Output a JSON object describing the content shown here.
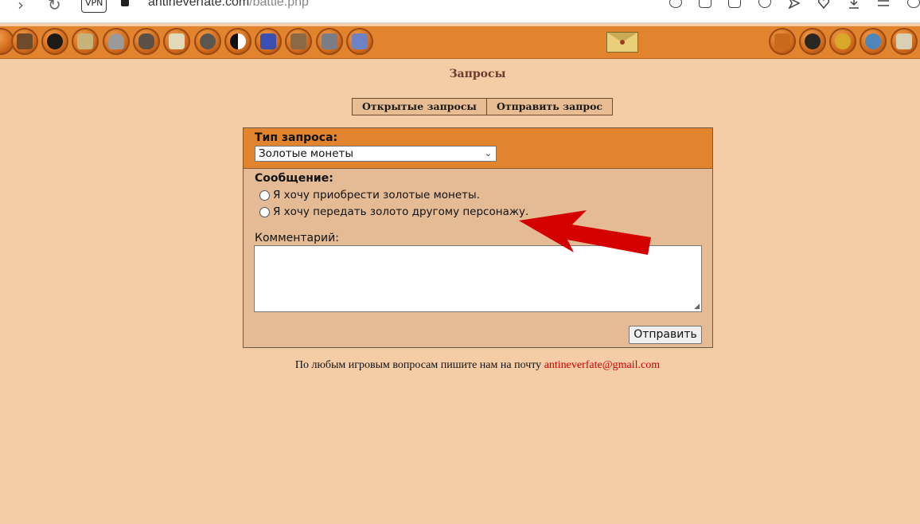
{
  "browser": {
    "vpn_label": "VPN",
    "url_domain": "antineverfate.com",
    "url_path": "/battle.php"
  },
  "toolbar": {
    "left_icons": [
      "castle-gate-icon",
      "dragon-icon",
      "book-icon",
      "helmet-icon",
      "tiger-icon",
      "scroll-icon",
      "pentagram-icon",
      "yin-yang-icon",
      "crossed-swords-icon",
      "fence-icon",
      "ship-icon",
      "tools-icon"
    ],
    "mail_icon": "envelope-icon",
    "right_icons": [
      "home-icon",
      "exit-icon",
      "help-icon",
      "info-icon",
      "rules-book-icon"
    ]
  },
  "page": {
    "title": "Запросы",
    "tabs": [
      {
        "label": "Открытые запросы"
      },
      {
        "label": "Отправить запрос"
      }
    ]
  },
  "form": {
    "type_label": "Тип запроса:",
    "type_selected": "Золотые монеты",
    "message_label": "Сообщение:",
    "options": [
      {
        "label": "Я хочу приобрести золотые монеты."
      },
      {
        "label": "Я хочу передать золото другому персонажу."
      }
    ],
    "comment_label": "Комментарий:",
    "comment_value": "",
    "submit_label": "Отправить"
  },
  "footer": {
    "text": "По любым игровым вопросам пишите нам на почту",
    "email": "antineverfate@gmail.com"
  },
  "colors": {
    "page_bg": "#f4cca6",
    "toolbar_bg": "#e2832e",
    "panel_bg": "#e4bb95",
    "arrow": "#d40000",
    "email": "#d00000"
  }
}
